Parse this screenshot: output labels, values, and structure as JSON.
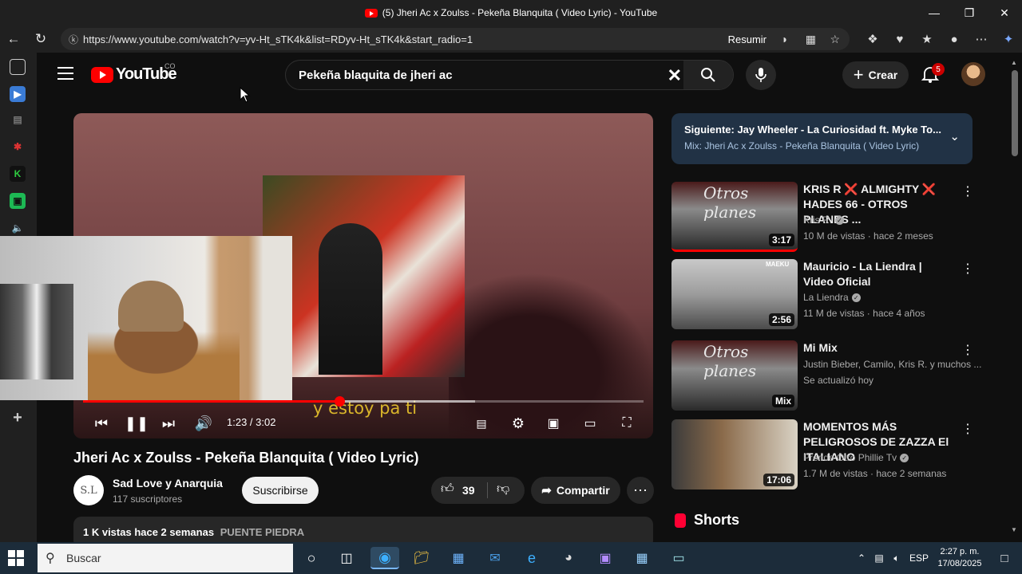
{
  "window": {
    "title": "(5) Jheri Ac x Zoulss - Pekeña Blanquita ( Video Lyric) - YouTube",
    "controls": [
      "minimize",
      "maximize",
      "close"
    ]
  },
  "browser": {
    "url": "https://www.youtube.com/watch?v=yv-Ht_sTK4k&list=RDyv-Ht_sTK4k&start_radio=1",
    "summarize_label": "Resumir"
  },
  "youtube": {
    "logo_text": "YouTube",
    "country_code": "CO",
    "search_value": "Pekeña blaquita  de jheri ac",
    "create_label": "Crear",
    "notification_count": "5"
  },
  "player": {
    "caption": "y estoy pa ti",
    "time": "1:23 / 3:02",
    "progress_fraction": 0.457,
    "buffered_fraction": 0.7
  },
  "video": {
    "title": "Jheri Ac x Zoulss - Pekeña Blanquita ( Video Lyric)",
    "channel_initials": "S.L",
    "channel_name": "Sad Love y Anarquia",
    "subscribers": "117 suscriptores",
    "subscribe_label": "Suscribirse",
    "likes": "39",
    "share_label": "Compartir",
    "views": "1 K vistas  hace 2 semanas",
    "location_tag": "PUENTE PIEDRA"
  },
  "next": {
    "title": "Siguiente: Jay Wheeler - La Curiosidad ft. Myke To...",
    "mix": "Mix: Jheri Ac x Zoulss - Pekeña Blanquita ( Video Lyric)"
  },
  "recommendations": [
    {
      "title": "KRIS R ❌ ALMIGHTY ❌ HADES 66 - OTROS PLANES ...",
      "channel": "Kris R.",
      "meta": "10 M de vistas · hace 2 meses",
      "duration": "3:17",
      "thumb_text": "Otros planes"
    },
    {
      "title": "Mauricio - La Liendra | Video Oficial",
      "channel": "La Liendra",
      "meta": "11 M de vistas · hace 4 años",
      "duration": "2:56",
      "thumb_text": "MAEKU"
    },
    {
      "title": "Mi Mix",
      "channel": "Justin Bieber, Camilo, Kris R. y muchos ...",
      "meta": "Se actualizó hoy",
      "duration": "Mix",
      "thumb_text": "Otros planes"
    },
    {
      "title": "MOMENTOS MÁS PELIGROSOS DE ZAZZA El ITALIANO",
      "channel": "Prende Otro Phillie Tv",
      "meta": "1.7 M de vistas · hace 2 semanas",
      "duration": "17:06",
      "thumb_text": ""
    }
  ],
  "shorts_label": "Shorts",
  "taskbar": {
    "search_placeholder": "Buscar",
    "language": "ESP",
    "time": "2:27 p. m.",
    "date": "17/08/2025"
  }
}
